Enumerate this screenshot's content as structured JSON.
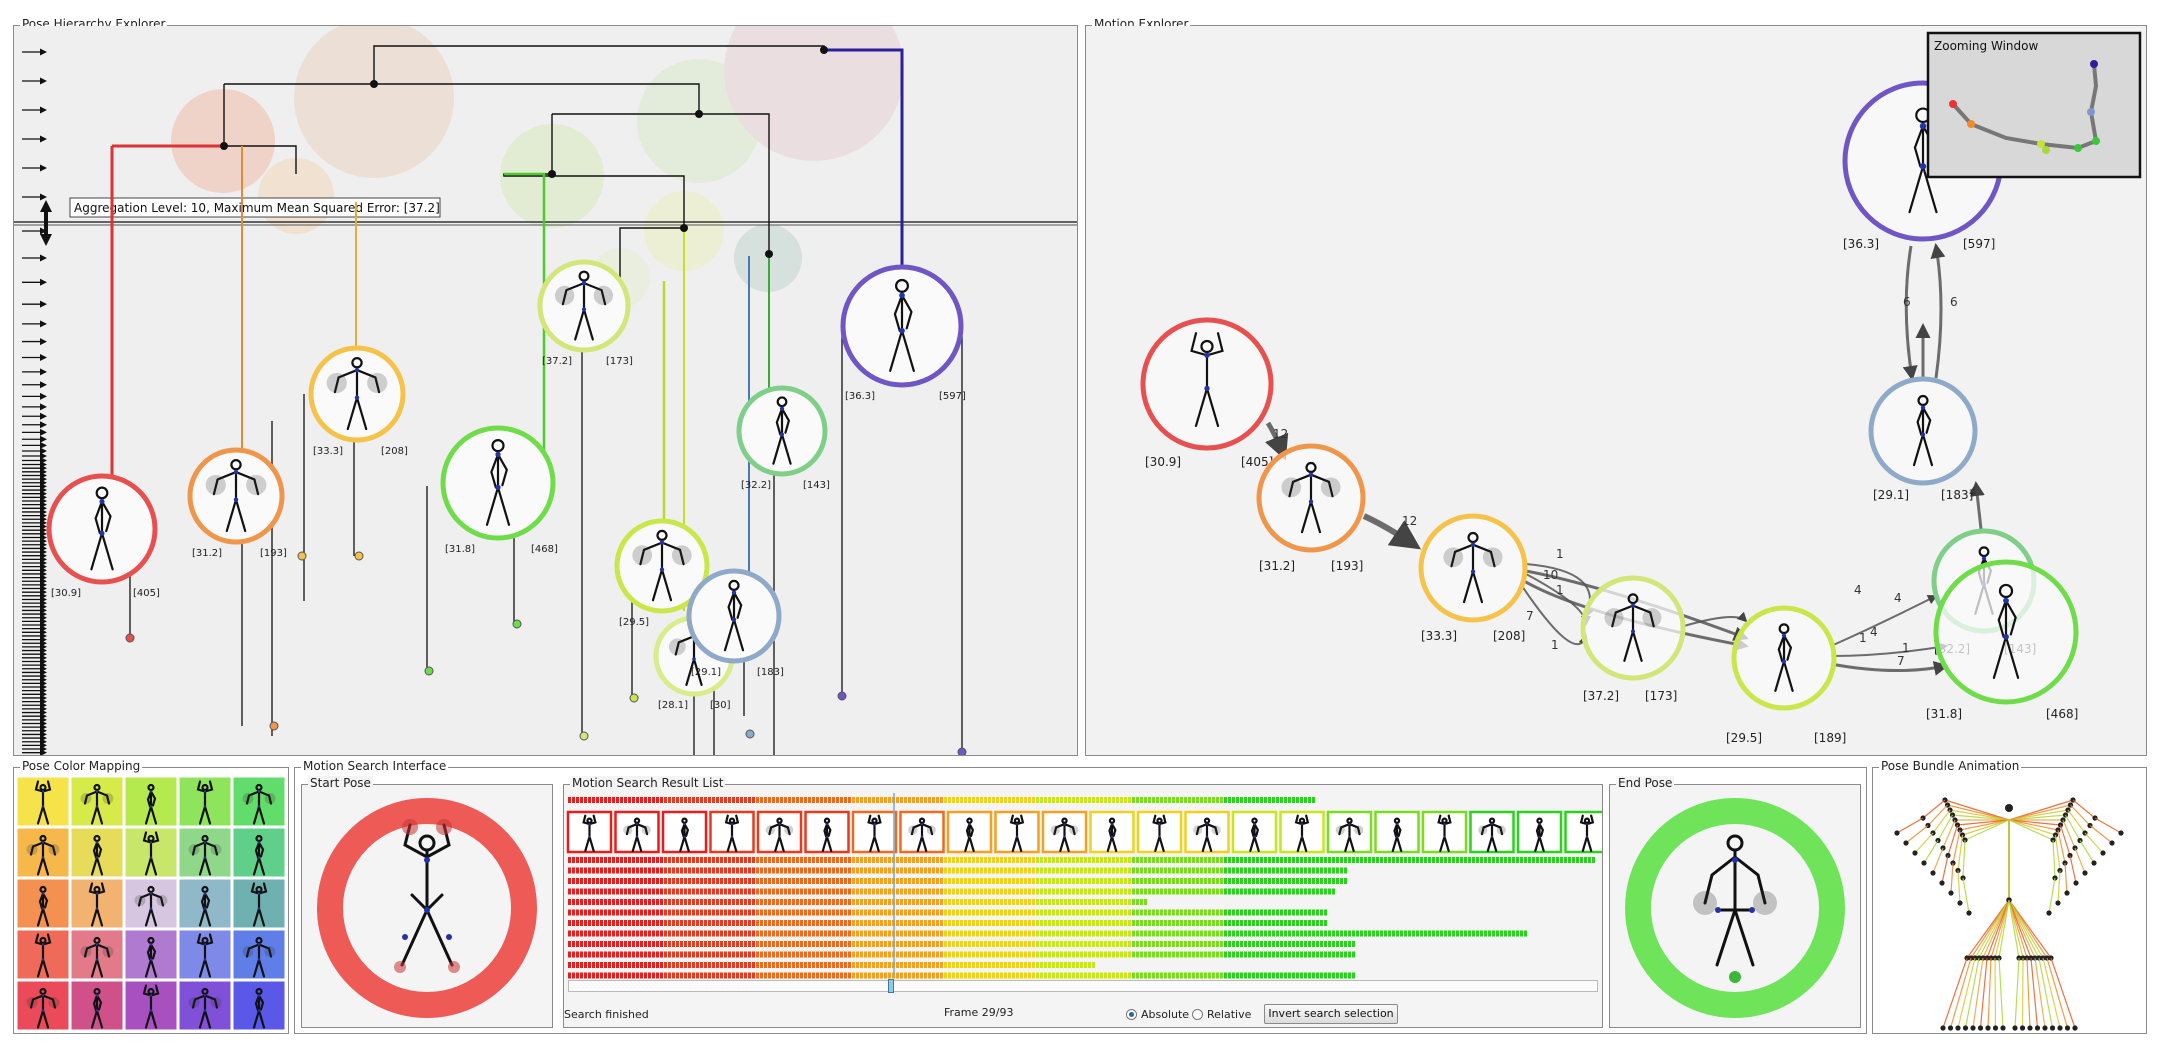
{
  "panels": {
    "hierarchy": "Pose Hierarchy Explorer",
    "motion": "Motion Explorer",
    "colormap": "Pose Color Mapping",
    "search": "Motion Search Interface",
    "start": "Start Pose",
    "results": "Motion Search Result List",
    "end": "End Pose",
    "bundle": "Pose Bundle Animation",
    "zoom": "Zooming Window"
  },
  "hierarchy": {
    "tooltip": "Aggregation Level: 10, Maximum Mean Squared Error: [37.2]",
    "clusters": [
      {
        "err": "[30.9]",
        "count": "[405]",
        "color": "#e8504f"
      },
      {
        "err": "[31.2]",
        "count": "[193]",
        "color": "#f0964a"
      },
      {
        "err": "[33.3]",
        "count": "[208]",
        "color": "#f5c24a"
      },
      {
        "err": "[31.8]",
        "count": "[468]",
        "color": "#6fdc4a"
      },
      {
        "err": "[37.2]",
        "count": "[173]",
        "color": "#d3e67a"
      },
      {
        "err": "[29.5]",
        "count": "[189]",
        "color": "#c9e64a"
      },
      {
        "err": "[28.1]",
        "count": "[30]",
        "color": "#d8ec8a"
      },
      {
        "err": "[29.1]",
        "count": "[183]",
        "color": "#8fa9c8"
      },
      {
        "err": "[32.2]",
        "count": "[143]",
        "color": "#7fcf88"
      },
      {
        "err": "[36.3]",
        "count": "[597]",
        "color": "#6f56c4"
      }
    ]
  },
  "motion": {
    "nodes": [
      {
        "err": "[30.9]",
        "count": "[405]",
        "color": "#e8504f"
      },
      {
        "err": "[31.2]",
        "count": "[193]",
        "color": "#f0964a"
      },
      {
        "err": "[33.3]",
        "count": "[208]",
        "color": "#f5c24a"
      },
      {
        "err": "[37.2]",
        "count": "[173]",
        "color": "#d3e67a"
      },
      {
        "err": "[29.5]",
        "count": "[189]",
        "color": "#c9e64a"
      },
      {
        "err": "[32.2]",
        "count": "[143]",
        "color": "#7fcf88"
      },
      {
        "err": "[31.8]",
        "count": "[468]",
        "color": "#6fdc4a"
      },
      {
        "err": "[29.1]",
        "count": "[183]",
        "color": "#8fa9c8"
      },
      {
        "err": "[36.3]",
        "count": "[597]",
        "color": "#6f56c4"
      }
    ],
    "edge_labels": [
      "12",
      "12",
      "1",
      "10",
      "1",
      "7",
      "1",
      "4",
      "4",
      "1",
      "1",
      "4",
      "7",
      "4",
      "6",
      "6"
    ]
  },
  "colormap": {
    "colors": [
      [
        "#f6e34a",
        "#d6ea4a",
        "#b4ea4e",
        "#8ee45a",
        "#62dc6a"
      ],
      [
        "#f6b84a",
        "#e6dc5a",
        "#c7e66a",
        "#8fd88a",
        "#5fcf8a"
      ],
      [
        "#f49050",
        "#f2b270",
        "#d6c6e0",
        "#8fb8c8",
        "#6fb0b0"
      ],
      [
        "#f06a5a",
        "#e27a8a",
        "#b07ad0",
        "#7f8ae8",
        "#5f7ee8"
      ],
      [
        "#ea4a5a",
        "#d0508a",
        "#a850c0",
        "#8050d8",
        "#5a58e8"
      ]
    ]
  },
  "results": {
    "status": "Search finished",
    "frame": "Frame 29/93",
    "absolute": "Absolute",
    "relative": "Relative",
    "invert": "Invert search selection",
    "slider_value": 0.31
  }
}
